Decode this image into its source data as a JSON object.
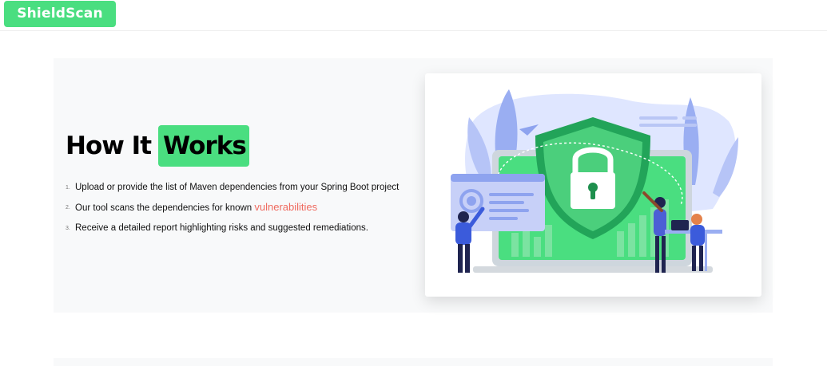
{
  "brand": {
    "name": "ShieldScan"
  },
  "how_it_works": {
    "title_plain": "How It",
    "title_highlight": "Works",
    "steps": [
      {
        "number": "1.",
        "text": "Upload or provide the list of Maven dependencies from your Spring Boot project"
      },
      {
        "number": "2.",
        "text_before": "Our tool scans the dependencies for known ",
        "accent": "vulnerabilities"
      },
      {
        "number": "3.",
        "text": "Receive a detailed report highlighting risks and suggested remediations."
      }
    ]
  },
  "colors": {
    "brand_green": "#4ade80",
    "accent_red": "#ef6a5f",
    "section_bg": "#f8f9fa"
  },
  "illustration": {
    "subject": "security-shield-lock-illustration"
  }
}
